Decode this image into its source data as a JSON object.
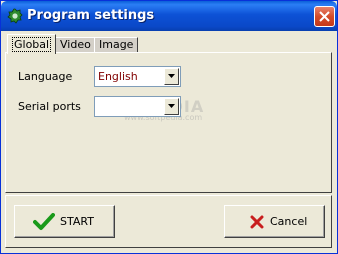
{
  "window": {
    "title": "Program settings",
    "app_icon": "app-gear-icon",
    "close_icon": "close-icon"
  },
  "tabs": [
    {
      "label": "Global",
      "active": true
    },
    {
      "label": "Video",
      "active": false
    },
    {
      "label": "Image",
      "active": false
    }
  ],
  "global": {
    "language_label": "Language",
    "language_value": "English",
    "serial_label": "Serial ports",
    "serial_value": ""
  },
  "watermark": {
    "text": "SOFTPEDIA",
    "sub": "www.softpedia.com"
  },
  "buttons": {
    "start_label": "START",
    "start_icon": "checkmark-icon",
    "cancel_label": "Cancel",
    "cancel_icon": "x-icon"
  },
  "colors": {
    "titlebar": "#0a48c8",
    "close": "#d44c29",
    "language_value": "#800000",
    "checkmark": "#1a9a1a",
    "cancel_x": "#c81e1e"
  }
}
